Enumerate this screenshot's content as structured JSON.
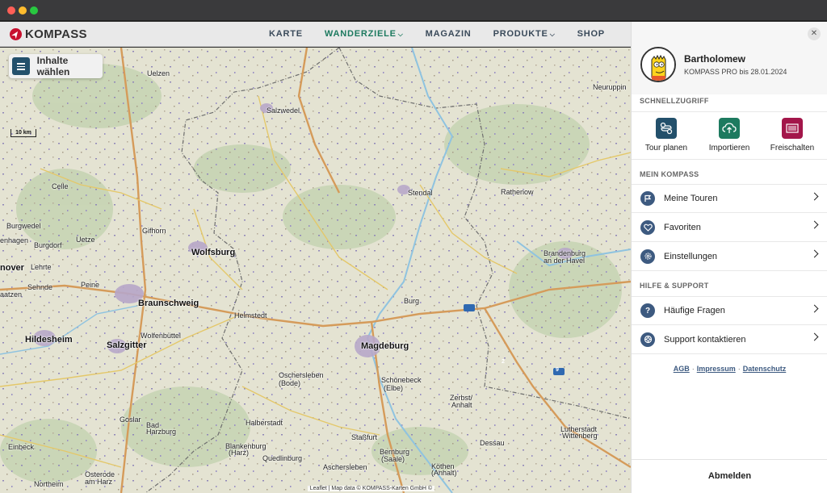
{
  "brand": {
    "name": "KOMPASS"
  },
  "nav": {
    "items": [
      {
        "label": "KARTE",
        "active": false,
        "dropdown": false
      },
      {
        "label": "WANDERZIELE",
        "active": true,
        "dropdown": true
      },
      {
        "label": "MAGAZIN",
        "active": false,
        "dropdown": false
      },
      {
        "label": "PRODUKTE",
        "active": false,
        "dropdown": true
      },
      {
        "label": "SHOP",
        "active": false,
        "dropdown": false
      }
    ],
    "dropdown_icon": "chevron-down-icon"
  },
  "map": {
    "contents_button": "Inhalte wählen",
    "scale_label": "10 km",
    "attribution": "Leaflet | Map data © KOMPASS-Karten GmbH ©",
    "cities": [
      {
        "name": "Uelzen",
        "big": false
      },
      {
        "name": "Salzwedel",
        "big": false
      },
      {
        "name": "Celle",
        "big": false
      },
      {
        "name": "Burgwedel",
        "big": false
      },
      {
        "name": "Uetze",
        "big": false
      },
      {
        "name": "Gifhorn",
        "big": false
      },
      {
        "name": "enhagen",
        "big": false
      },
      {
        "name": "Burgdorf",
        "big": false
      },
      {
        "name": "Wolfsburg",
        "big": true
      },
      {
        "name": "nover",
        "big": true
      },
      {
        "name": "Lehrte",
        "big": false
      },
      {
        "name": "Sehnde",
        "big": false
      },
      {
        "name": "Peine",
        "big": false
      },
      {
        "name": "aatzen",
        "big": false
      },
      {
        "name": "Braunschweig",
        "big": true
      },
      {
        "name": "Helmstedt",
        "big": false
      },
      {
        "name": "Hildesheim",
        "big": true
      },
      {
        "name": "Wolfenbüttel",
        "big": false
      },
      {
        "name": "Salzgitter",
        "big": true
      },
      {
        "name": "Magdeburg",
        "big": true
      },
      {
        "name": "Stendal",
        "big": false
      },
      {
        "name": "Rathenow",
        "big": false
      },
      {
        "name": "Burg",
        "big": false
      },
      {
        "name": "Oschersleben",
        "big": false
      },
      {
        "name": "(Bode)",
        "big": false
      },
      {
        "name": "Schönebeck",
        "big": false
      },
      {
        "name": "(Elbe)",
        "big": false
      },
      {
        "name": "Zerbst/",
        "big": false
      },
      {
        "name": "Anhalt",
        "big": false
      },
      {
        "name": "Halberstadt",
        "big": false
      },
      {
        "name": "Goslar",
        "big": false
      },
      {
        "name": "Bad",
        "big": false
      },
      {
        "name": "Harzburg",
        "big": false
      },
      {
        "name": "Einbeck",
        "big": false
      },
      {
        "name": "Blankenburg",
        "big": false
      },
      {
        "name": "(Harz)",
        "big": false
      },
      {
        "name": "Staßfurt",
        "big": false
      },
      {
        "name": "Quedlinburg",
        "big": false
      },
      {
        "name": "Bernburg",
        "big": false
      },
      {
        "name": "(Saale)",
        "big": false
      },
      {
        "name": "Aschersleben",
        "big": false
      },
      {
        "name": "Dessau",
        "big": false
      },
      {
        "name": "Köthen",
        "big": false
      },
      {
        "name": "(Anhalt)",
        "big": false
      },
      {
        "name": "Osterode",
        "big": false
      },
      {
        "name": "am Harz",
        "big": false
      },
      {
        "name": "Northeim",
        "big": false
      },
      {
        "name": "Neuruppin",
        "big": false
      },
      {
        "name": "Brandenburg",
        "big": false
      },
      {
        "name": "an der Havel",
        "big": false
      },
      {
        "name": "Lutherstadt",
        "big": false
      },
      {
        "name": "Wittenberg",
        "big": false
      }
    ],
    "highway_labels": [
      "2",
      "9"
    ]
  },
  "panel": {
    "user_name": "Bartholomew",
    "subscription": "KOMPASS PRO bis 28.01.2024",
    "quick_access_title": "SCHNELLZUGRIFF",
    "quick_actions": [
      {
        "label": "Tour planen",
        "icon": "route-plan-icon",
        "color": "#23506b"
      },
      {
        "label": "Importieren",
        "icon": "cloud-upload-icon",
        "color": "#1d7a5f"
      },
      {
        "label": "Freischalten",
        "icon": "barcode-icon",
        "color": "#a3164a"
      }
    ],
    "my_kompass_title": "MEIN KOMPASS",
    "my_kompass_items": [
      {
        "label": "Meine Touren",
        "icon": "flag-icon"
      },
      {
        "label": "Favoriten",
        "icon": "heart-icon"
      },
      {
        "label": "Einstellungen",
        "icon": "gear-icon"
      }
    ],
    "help_title": "HILFE & SUPPORT",
    "help_items": [
      {
        "label": "Häufige Fragen",
        "icon": "question-icon"
      },
      {
        "label": "Support kontaktieren",
        "icon": "lifebuoy-icon"
      }
    ],
    "legal_links": [
      "AGB",
      "Impressum",
      "Datenschutz"
    ],
    "logout_label": "Abmelden"
  }
}
